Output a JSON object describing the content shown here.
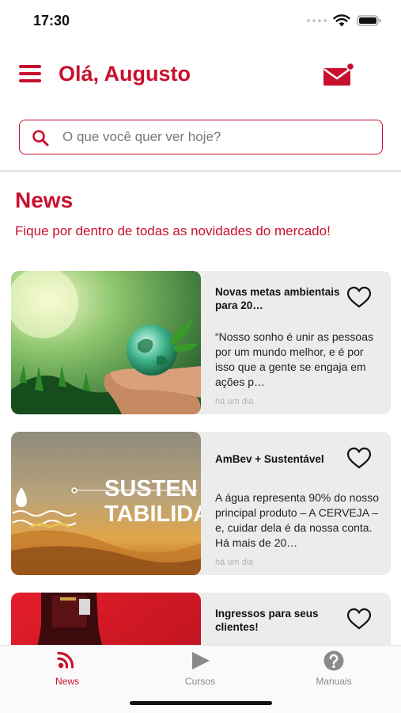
{
  "status_bar": {
    "time": "17:30"
  },
  "header": {
    "greeting": "Olá, Augusto"
  },
  "search": {
    "placeholder": "O que você quer ver hoje?"
  },
  "section": {
    "title": "News",
    "subtitle": "Fique por dentro de todas as novidades do mercado!"
  },
  "news": [
    {
      "title": "Novas metas ambientais para 20…",
      "excerpt": "“Nosso sonho é unir as pessoas por um mundo melhor, e é por isso que a gente se engaja em ações p…",
      "time": "há um dia"
    },
    {
      "title": "AmBev + Sustentável",
      "excerpt": "A água representa 90% do nosso principal produto – A CERVEJA – e, cuidar dela é da nossa conta. Há mais de 20…",
      "time": "há um dia",
      "image_text": [
        "SUSTEN",
        "TABILIDA"
      ]
    },
    {
      "title": "Ingressos para seus clientes!",
      "excerpt": "",
      "time": ""
    }
  ],
  "tabs": [
    {
      "label": "News",
      "icon": "rss-icon",
      "active": true
    },
    {
      "label": "Cursos",
      "icon": "play-icon",
      "active": false
    },
    {
      "label": "Manuais",
      "icon": "help-circle-icon",
      "active": false
    }
  ],
  "colors": {
    "brand": "#c8102e",
    "inactive": "#8a8a8a",
    "card": "#ececec"
  }
}
